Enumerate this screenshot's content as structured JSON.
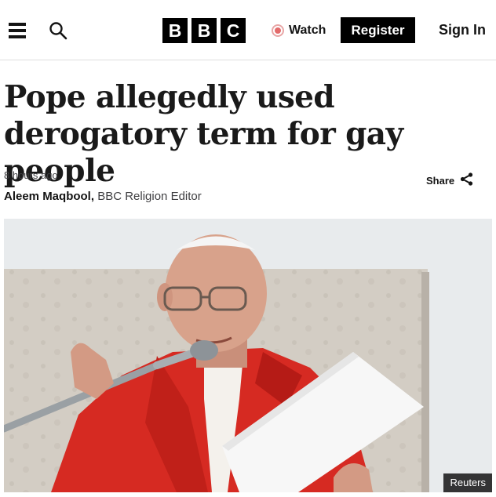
{
  "header": {
    "logo_letters": [
      "B",
      "B",
      "C"
    ],
    "watch_label": "Watch",
    "register_label": "Register",
    "signin_label": "Sign In",
    "icons": [
      "menu-icon",
      "search-icon",
      "watch-live-icon"
    ]
  },
  "article": {
    "headline": "Pope allegedly used derogatory term for gay people",
    "timestamp": "8 hours ago",
    "author_name": "Aleem Maqbool,",
    "author_role": "BBC Religion Editor",
    "share_label": "Share"
  },
  "hero_image": {
    "credit": "Reuters"
  },
  "colors": {
    "brand_black": "#000000",
    "text": "#141414",
    "watch_dot": "#e36b6b"
  }
}
